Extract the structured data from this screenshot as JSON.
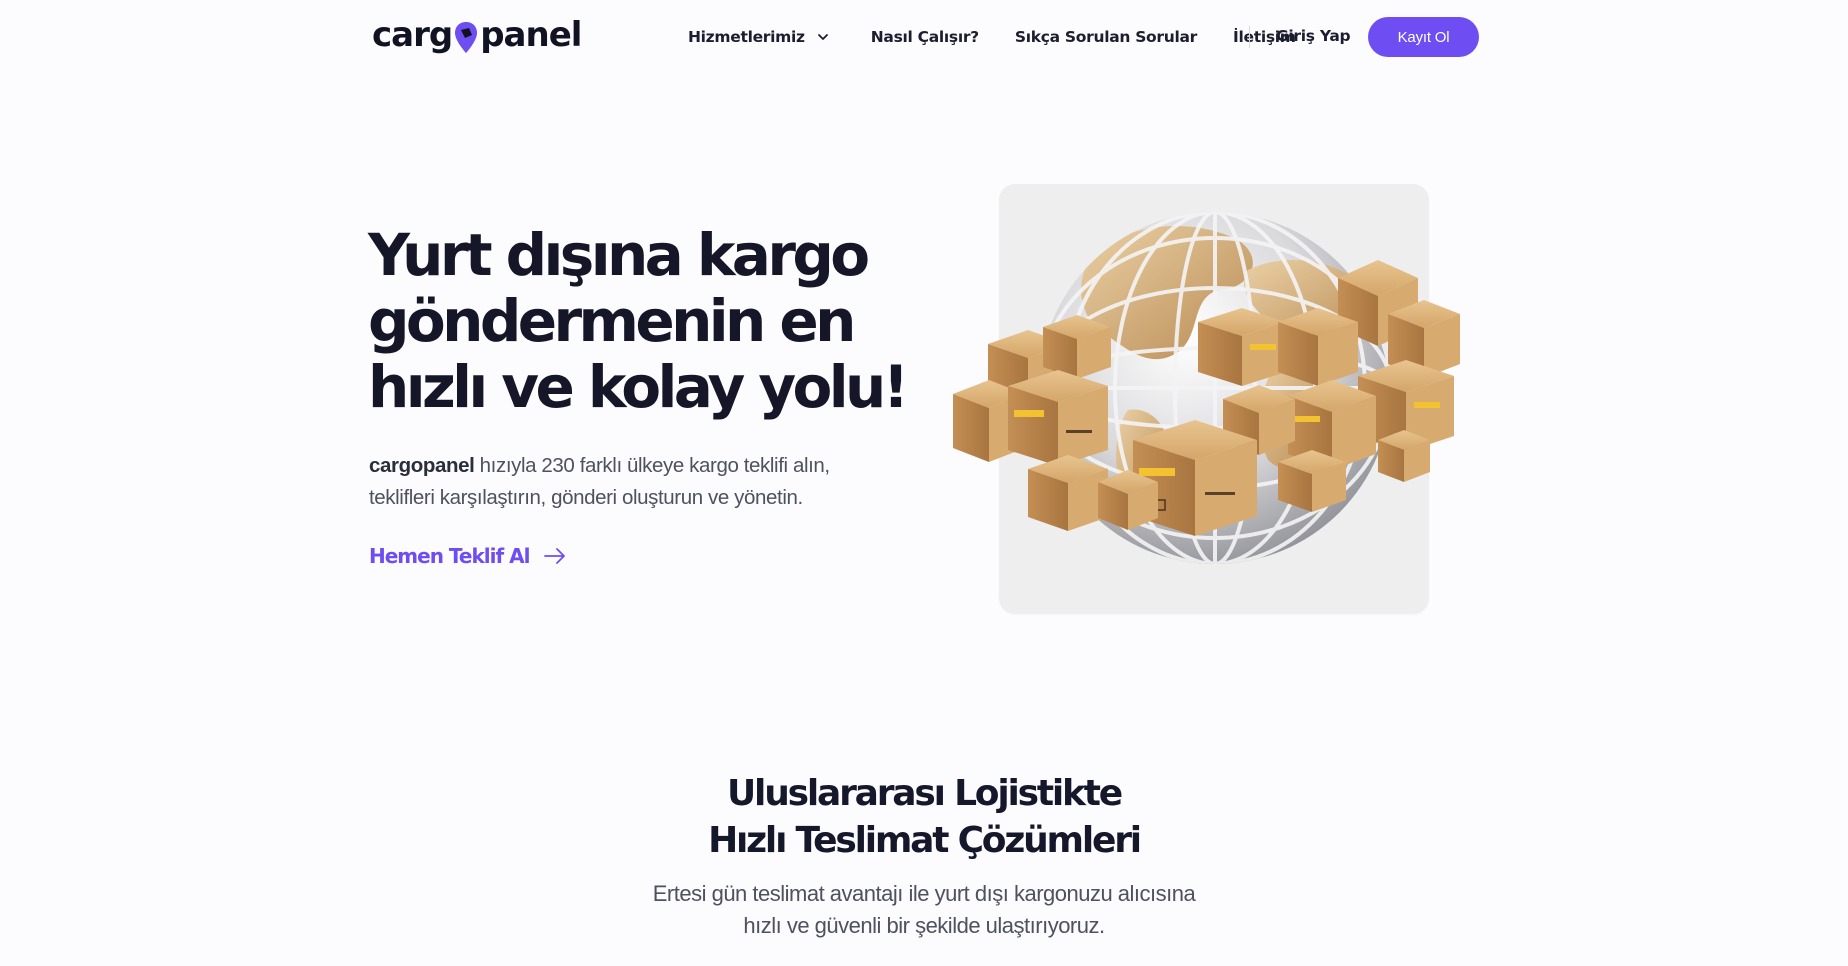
{
  "brand": {
    "name_part1": "carg",
    "name_part2": "panel",
    "accent": "#6e4df2"
  },
  "nav": {
    "items": [
      {
        "label": "Hizmetlerimiz",
        "icon": "chevron-down-icon"
      },
      {
        "label": "Nasıl Çalışır?"
      },
      {
        "label": "Sıkça Sorulan Sorular"
      },
      {
        "label": "İletişim"
      }
    ],
    "login_label": "Giriş Yap",
    "signup_label": "Kayıt Ol"
  },
  "hero": {
    "title_lines": [
      "Yurt dışına kargo",
      "göndermenin en",
      "hızlı ve kolay yolu!"
    ],
    "desc_brand": "cargopanel",
    "desc_line1_rest": " hızıyla 230 farklı ülkeye kargo teklifi alın,",
    "desc_line2": "teklifleri karşılaştırın, gönderi oluşturun ve yönetin.",
    "cta_label": "Hemen Teklif Al",
    "cta_icon": "arrow-right-icon",
    "image": "globe-with-cardboard-boxes-illustration"
  },
  "section": {
    "title_lines": [
      "Uluslararası Lojistikte",
      "Hızlı Teslimat Çözümleri"
    ],
    "subtitle_lines": [
      "Ertesi gün teslimat avantajı ile yurt dışı kargonuzu alıcısına",
      "hızlı ve güvenli bir şekilde ulaştırıyoruz."
    ]
  }
}
